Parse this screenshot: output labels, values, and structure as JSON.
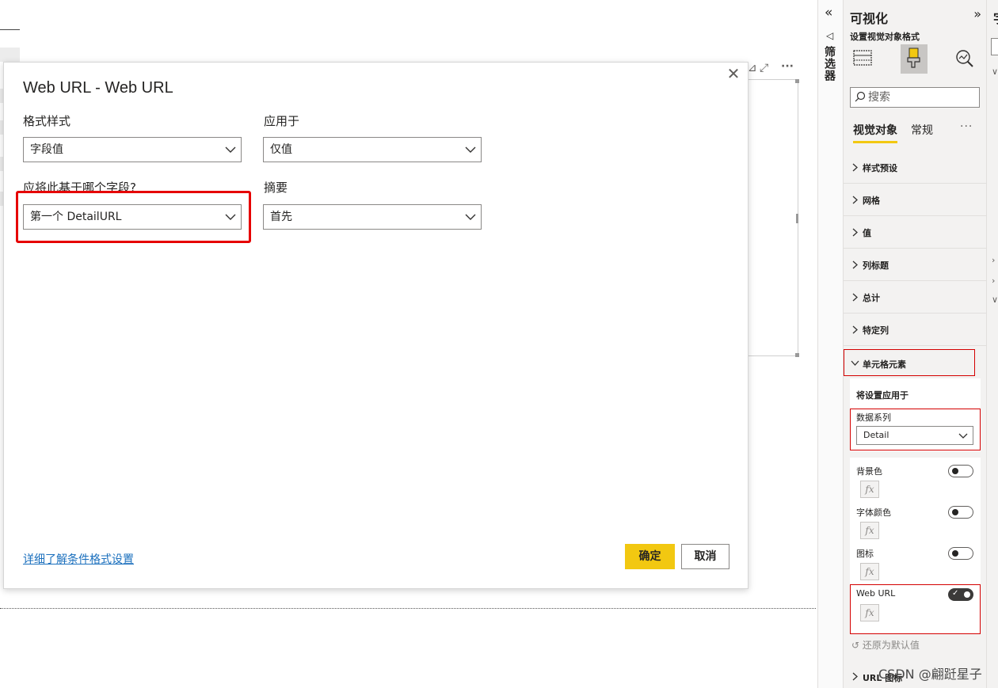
{
  "dialog": {
    "title": "Web URL - Web URL",
    "close_glyph": "✕",
    "format_style": {
      "label": "格式样式",
      "value": "字段值"
    },
    "apply_to": {
      "label": "应用于",
      "value": "仅值"
    },
    "based_on_field": {
      "label": "应将此基于哪个字段?",
      "value": "第一个 DetailURL"
    },
    "summarization": {
      "label": "摘要",
      "value": "首先"
    },
    "learn_more_link": "详细了解条件格式设置",
    "ok_label": "确定",
    "cancel_label": "取消"
  },
  "canvas": {
    "visual_header_icons": [
      "filter-icon",
      "focus-mode-icon",
      "more-options-icon"
    ],
    "more_glyph": "···",
    "focus_glyph": "⤢"
  },
  "filter_rail": {
    "collapse_glyph": "«",
    "funnel_glyph": "◁",
    "label": "筛选器"
  },
  "viz_pane": {
    "title": "可视化",
    "expand_glyph": "»",
    "subtitle": "设置视觉对象格式",
    "search_placeholder": "搜索",
    "tabs": [
      "视觉对象",
      "常规"
    ],
    "more_glyph": "···",
    "sections": [
      "样式预设",
      "网格",
      "值",
      "列标题",
      "总计",
      "特定列"
    ],
    "expanded_section": "单元格元素",
    "apply_settings_label": "将设置应用于",
    "series_label": "数据系列",
    "series_value": "Detail",
    "toggles": [
      {
        "label": "背景色",
        "on": false
      },
      {
        "label": "字体颜色",
        "on": false
      },
      {
        "label": "图标",
        "on": false
      },
      {
        "label": "Web URL",
        "on": true
      }
    ],
    "fx_glyph": "fx",
    "reset_label": "还原为默认值",
    "next_section": "URL 图标",
    "watermark": "CSDN @翩跹星子"
  },
  "fields_pane": {
    "title_fragment": "字"
  },
  "colors": {
    "accent_yellow": "#f2c811",
    "highlight_red": "#e60000",
    "link_blue": "#1a6fbd"
  }
}
